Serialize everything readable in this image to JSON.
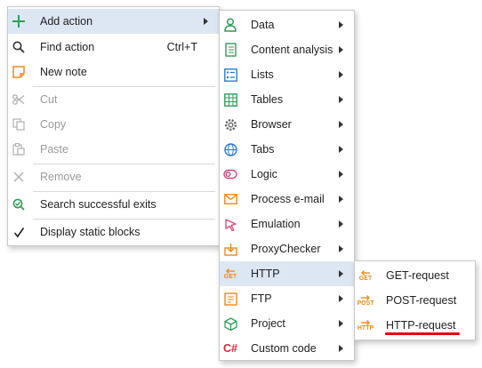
{
  "main_menu": {
    "items": [
      {
        "label": "Add action",
        "icon": "plus-icon"
      },
      {
        "label": "Find action",
        "shortcut": "Ctrl+T",
        "icon": "search-icon"
      },
      {
        "label": "New note",
        "icon": "note-icon"
      },
      {
        "label": "Cut",
        "icon": "scissors-icon",
        "disabled": true
      },
      {
        "label": "Copy",
        "icon": "copy-icon",
        "disabled": true
      },
      {
        "label": "Paste",
        "icon": "paste-icon",
        "disabled": true
      },
      {
        "label": "Remove",
        "icon": "close-icon",
        "disabled": true
      },
      {
        "label": "Search successful exits",
        "icon": "search-check-icon"
      },
      {
        "label": "Display static blocks",
        "icon": "checkmark-icon"
      }
    ]
  },
  "add_action_submenu": {
    "items": [
      {
        "label": "Data",
        "icon": "person-icon"
      },
      {
        "label": "Content analysis",
        "icon": "document-icon"
      },
      {
        "label": "Lists",
        "icon": "list-icon"
      },
      {
        "label": "Tables",
        "icon": "table-icon"
      },
      {
        "label": "Browser",
        "icon": "gear-icon"
      },
      {
        "label": "Tabs",
        "icon": "globe-icon"
      },
      {
        "label": "Logic",
        "icon": "logic-icon"
      },
      {
        "label": "Process e-mail",
        "icon": "envelope-icon"
      },
      {
        "label": "Emulation",
        "icon": "cursor-icon"
      },
      {
        "label": "ProxyChecker",
        "icon": "proxy-icon"
      },
      {
        "label": "HTTP",
        "icon": "http-get-icon",
        "icon_text": "GET"
      },
      {
        "label": "FTP",
        "icon": "ftp-icon"
      },
      {
        "label": "Project",
        "icon": "cube-icon"
      },
      {
        "label": "Custom code",
        "icon": "csharp-icon",
        "icon_text": "C#"
      }
    ]
  },
  "http_submenu": {
    "items": [
      {
        "label": "GET-request",
        "icon": "get-request-icon",
        "icon_text": "GET"
      },
      {
        "label": "POST-request",
        "icon": "post-request-icon",
        "icon_text": "POST"
      },
      {
        "label": "HTTP-request",
        "icon": "http-request-icon",
        "icon_text": "HTTP"
      }
    ]
  },
  "colors": {
    "highlight": "#dde6f3",
    "accent_orange": "#f08a1c",
    "underline_red": "#e00000",
    "disabled_text": "#9a9a9a"
  }
}
